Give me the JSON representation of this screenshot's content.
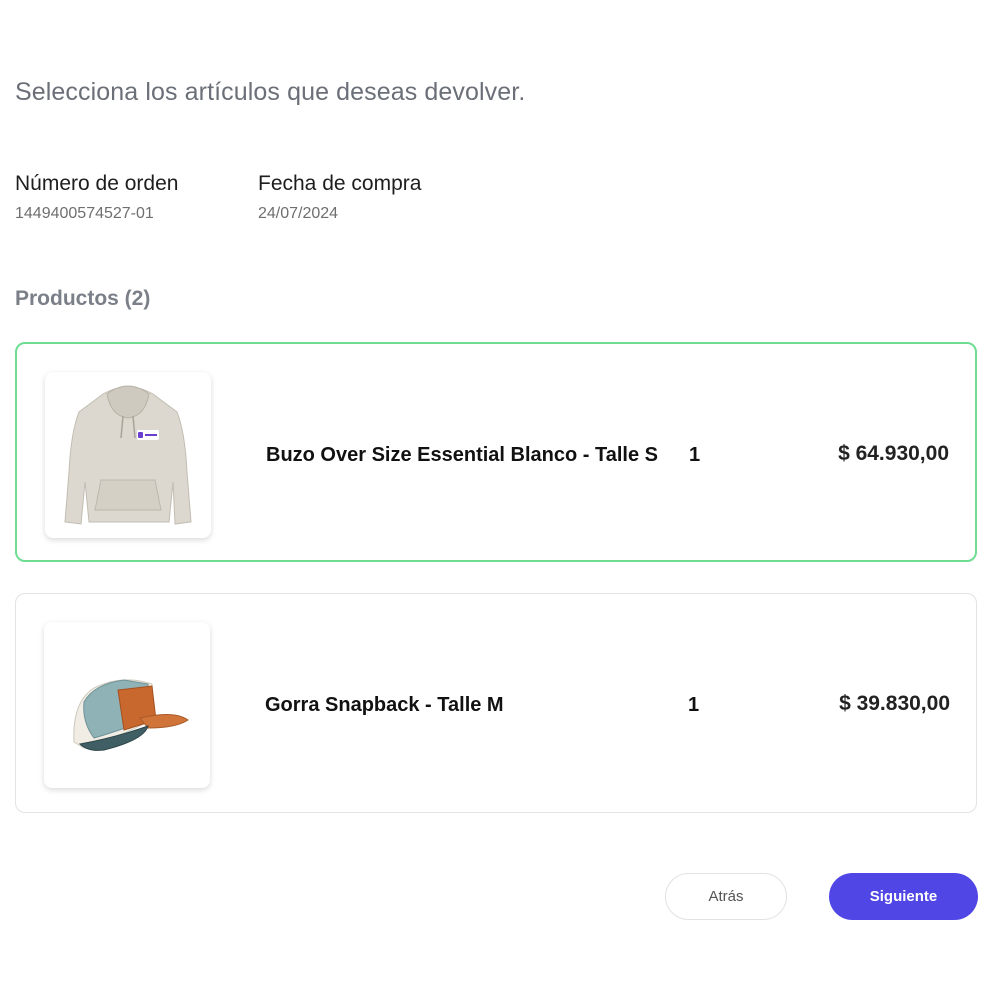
{
  "page": {
    "heading": "Selecciona los artículos que deseas devolver."
  },
  "order": {
    "number_label": "Número de orden",
    "number_value": "1449400574527-01",
    "date_label": "Fecha de compra",
    "date_value": "24/07/2024"
  },
  "products": {
    "title": "Productos (2)",
    "items": [
      {
        "name": "Buzo Over Size Essential Blanco - Talle S",
        "quantity": "1",
        "price": "$ 64.930,00",
        "icon": "hoodie-image",
        "selected": true
      },
      {
        "name": "Gorra Snapback - Talle M",
        "quantity": "1",
        "price": "$ 39.830,00",
        "icon": "cap-image",
        "selected": false
      }
    ]
  },
  "actions": {
    "back_label": "Atrás",
    "next_label": "Siguiente"
  },
  "colors": {
    "accent": "#4f46e5",
    "selected_border": "#6fdc93"
  }
}
